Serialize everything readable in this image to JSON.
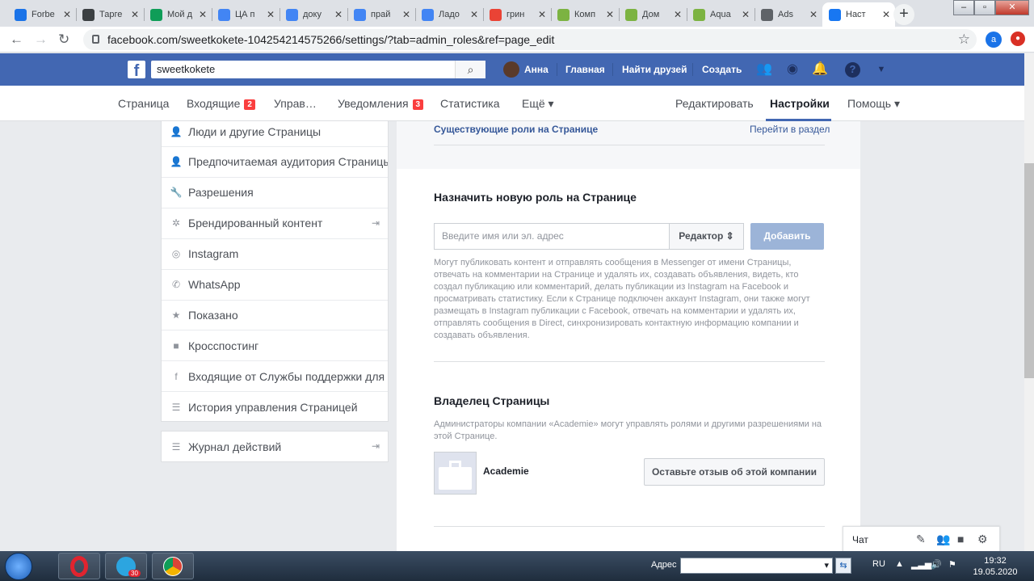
{
  "browser": {
    "tabs": [
      {
        "title": "Forbe",
        "icon": "globe-icon",
        "color": "#1a73e8"
      },
      {
        "title": "Тарге",
        "icon": "gc-icon",
        "color": "#3c4043"
      },
      {
        "title": "Мой д",
        "icon": "drive-icon",
        "color": "#0f9d58"
      },
      {
        "title": "ЦА п",
        "icon": "docs-icon",
        "color": "#4285f4"
      },
      {
        "title": "доку",
        "icon": "docs-icon",
        "color": "#4285f4"
      },
      {
        "title": "прай",
        "icon": "docs-icon",
        "color": "#4285f4"
      },
      {
        "title": "Ладо",
        "icon": "docs-icon",
        "color": "#4285f4"
      },
      {
        "title": "грин",
        "icon": "google-icon",
        "color": "#ea4335"
      },
      {
        "title": "Комп",
        "icon": "sheets-ok-icon",
        "color": "#7cb342"
      },
      {
        "title": "Дом",
        "icon": "sheets-ok-icon",
        "color": "#7cb342"
      },
      {
        "title": "Aqua",
        "icon": "sheets-ok-icon",
        "color": "#7cb342"
      },
      {
        "title": "Ads",
        "icon": "ads-icon",
        "color": "#5f6368"
      },
      {
        "title": "Наст",
        "icon": "facebook-icon",
        "color": "#1877f2",
        "active": true
      }
    ],
    "new_tab": "+",
    "url": "facebook.com/sweetkokete-104254214575266/settings/?tab=admin_roles&ref=page_edit",
    "profile_letter": "a"
  },
  "fb": {
    "search_value": "sweetkokete",
    "user_name": "Анна",
    "nav": [
      "Главная",
      "Найти друзей",
      "Создать"
    ]
  },
  "pagenav": {
    "items": [
      {
        "label": "Страница"
      },
      {
        "label": "Входящие",
        "badge": "2"
      },
      {
        "label": "Управ…"
      },
      {
        "label": "Уведомления",
        "badge": "3"
      },
      {
        "label": "Статистика"
      },
      {
        "label": "Ещё ▾"
      }
    ],
    "right": [
      "Редактировать",
      "Настройки",
      "Помощь ▾"
    ]
  },
  "sidebar": {
    "items": [
      {
        "label": "Люди и другие Страницы",
        "icon": "people-icon",
        "glyph": "👤"
      },
      {
        "label": "Предпочитаемая аудитория Страницы",
        "icon": "people-icon",
        "glyph": "👤"
      },
      {
        "label": "Разрешения",
        "icon": "wrench-icon",
        "glyph": "🔧"
      },
      {
        "label": "Брендированный контент",
        "icon": "handshake-icon",
        "glyph": "✲"
      },
      {
        "label": "Instagram",
        "icon": "instagram-icon",
        "glyph": "◎"
      },
      {
        "label": "WhatsApp",
        "icon": "whatsapp-icon",
        "glyph": "✆"
      },
      {
        "label": "Показано",
        "icon": "star-icon",
        "glyph": "★"
      },
      {
        "label": "Кросспостинг",
        "icon": "video-icon",
        "glyph": "■"
      },
      {
        "label": "Входящие от Службы поддержки для Страниц",
        "icon": "facebook-icon",
        "glyph": "f"
      },
      {
        "label": "История управления Страницей",
        "icon": "list-icon",
        "glyph": "☰"
      }
    ],
    "activity_log": "Журнал действий"
  },
  "main": {
    "existing_roles": "Существующие роли на Странице",
    "go_to_section": "Перейти в раздел",
    "assign_title": "Назначить новую роль на Странице",
    "input_placeholder": "Введите имя или эл. адрес",
    "role_select": "Редактор ⇕",
    "add_button": "Добавить",
    "role_description": "Могут публиковать контент и отправлять сообщения в Messenger от имени Страницы, отвечать на комментарии на Странице и удалять их, создавать объявления, видеть, кто создал публикацию или комментарий, делать публикации из Instagram на Facebook и просматривать статистику. Если к Странице подключен аккаунт Instagram, они также могут размещать в Instagram публикации с Facebook, отвечать на комментарии и удалять их, отправлять сообщения в Direct, синхронизировать контактную информацию компании и создавать объявления.",
    "owner_title": "Владелец Страницы",
    "owner_description": "Администраторы компании «Academie» могут управлять ролями и другими разрешениями на этой Странице.",
    "business_name": "Academie",
    "review_button": "Оставьте отзыв об этой компании"
  },
  "chat": {
    "label": "Чат"
  },
  "taskbar": {
    "address_label": "Адрес",
    "lang": "RU",
    "time": "19:32",
    "date": "19.05.2020",
    "telegram_badge": "30"
  }
}
